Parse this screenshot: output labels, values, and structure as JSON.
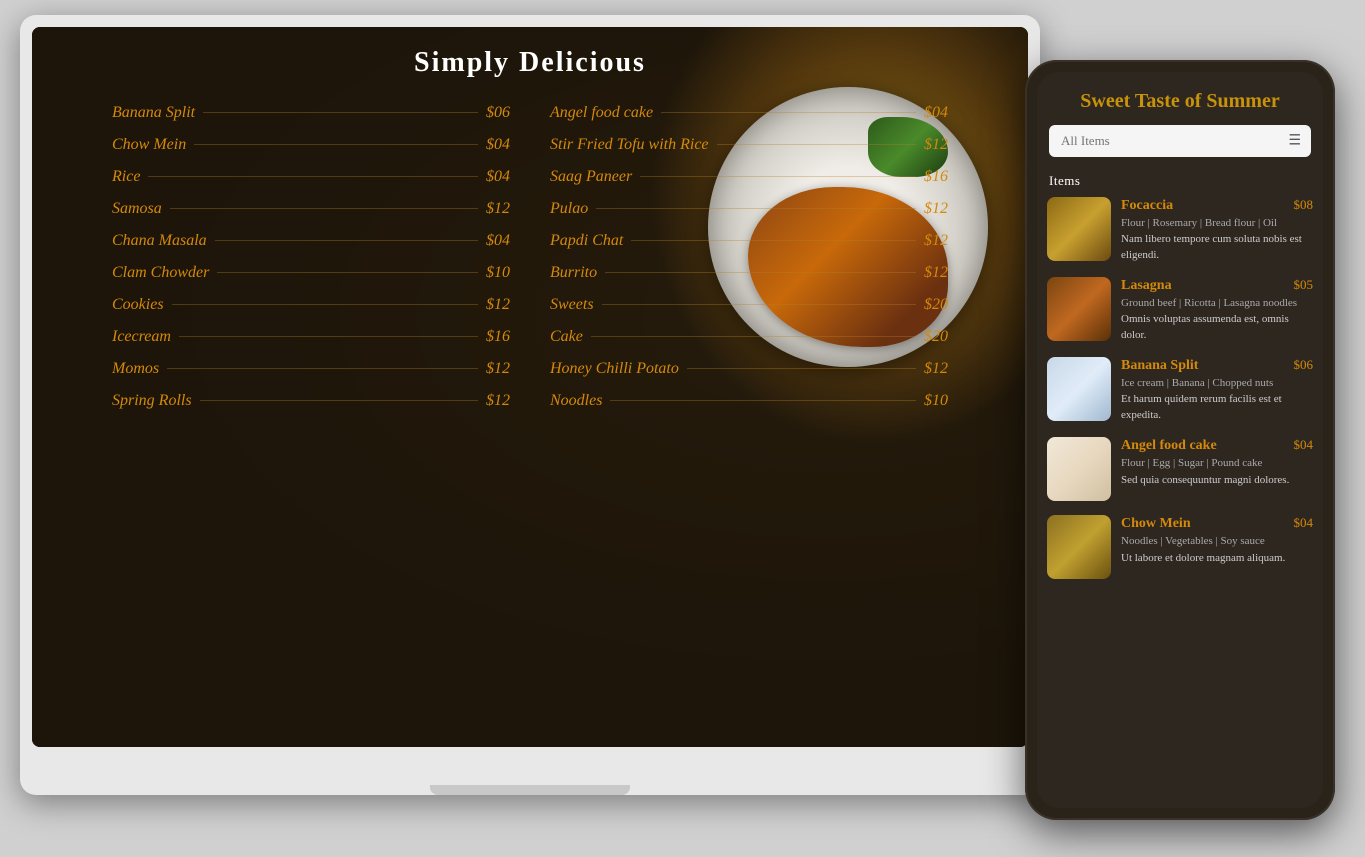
{
  "laptop": {
    "title": "Simply Delicious",
    "menu_col1": [
      {
        "name": "Banana Split",
        "price": "$06"
      },
      {
        "name": "Chow Mein",
        "price": "$04"
      },
      {
        "name": "Rice",
        "price": "$04"
      },
      {
        "name": "Samosa",
        "price": "$12"
      },
      {
        "name": "Chana Masala",
        "price": "$04"
      },
      {
        "name": "Clam Chowder",
        "price": "$10"
      },
      {
        "name": "Cookies",
        "price": "$12"
      },
      {
        "name": "Icecream",
        "price": "$16"
      },
      {
        "name": "Momos",
        "price": "$12"
      },
      {
        "name": "Spring Rolls",
        "price": "$12"
      }
    ],
    "menu_col2": [
      {
        "name": "Angel food cake",
        "price": "$04"
      },
      {
        "name": "Stir Fried Tofu with Rice",
        "price": "$12"
      },
      {
        "name": "Saag Paneer",
        "price": "$16"
      },
      {
        "name": "Pulao",
        "price": "$12"
      },
      {
        "name": "Papdi Chat",
        "price": "$12"
      },
      {
        "name": "Burrito",
        "price": "$12"
      },
      {
        "name": "Sweets",
        "price": "$20"
      },
      {
        "name": "Cake",
        "price": "$20"
      },
      {
        "name": "Honey Chilli Potato",
        "price": "$12"
      },
      {
        "name": "Noodles",
        "price": "$10"
      }
    ]
  },
  "phone": {
    "title": "Sweet Taste of Summer",
    "search_placeholder": "All Items",
    "items_label": "Items",
    "menu_items": [
      {
        "name": "Focaccia",
        "price": "$08",
        "ingredients": "Flour | Rosemary | Bread flour | Oil",
        "description": "Nam libero tempore cum soluta nobis est eligendi."
      },
      {
        "name": "Lasagna",
        "price": "$05",
        "ingredients": "Ground beef | Ricotta | Lasagna noodles",
        "description": "Omnis voluptas assumenda est, omnis dolor."
      },
      {
        "name": "Banana Split",
        "price": "$06",
        "ingredients": "Ice cream | Banana | Chopped nuts",
        "description": "Et harum quidem rerum facilis est et expedita."
      },
      {
        "name": "Angel food cake",
        "price": "$04",
        "ingredients": "Flour | Egg | Sugar | Pound cake",
        "description": "Sed quia consequuntur magni dolores."
      },
      {
        "name": "Chow Mein",
        "price": "$04",
        "ingredients": "Noodles | Vegetables | Soy sauce",
        "description": "Ut labore et dolore magnam aliquam."
      }
    ]
  }
}
